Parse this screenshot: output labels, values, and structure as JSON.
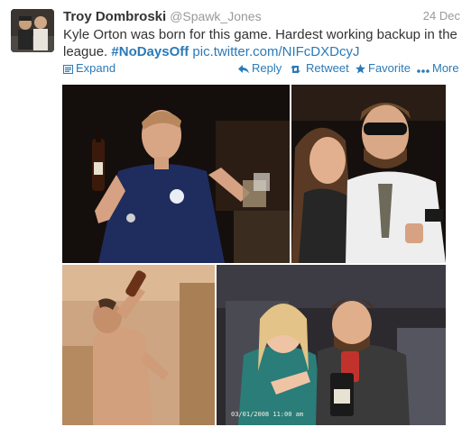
{
  "tweet": {
    "fullname": "Troy Dombroski",
    "handle": "@Spawk_Jones",
    "date": "24 Dec",
    "text_plain": "Kyle Orton was born for this game. Hardest working backup in the league. ",
    "hashtag": "#NoDaysOff",
    "link": "pic.twitter.com/NIFcDXDcyJ"
  },
  "actions": {
    "expand": "Expand",
    "reply": "Reply",
    "retweet": "Retweet",
    "favorite": "Favorite",
    "more": "More"
  },
  "photo": {
    "timestamp": "03/01/2008 11:00 am"
  },
  "colors": {
    "link": "#2a7ab8",
    "name": "#333333",
    "meta": "#999999"
  },
  "icons": [
    "expand-icon",
    "reply-icon",
    "retweet-icon",
    "favorite-icon",
    "more-icon"
  ]
}
